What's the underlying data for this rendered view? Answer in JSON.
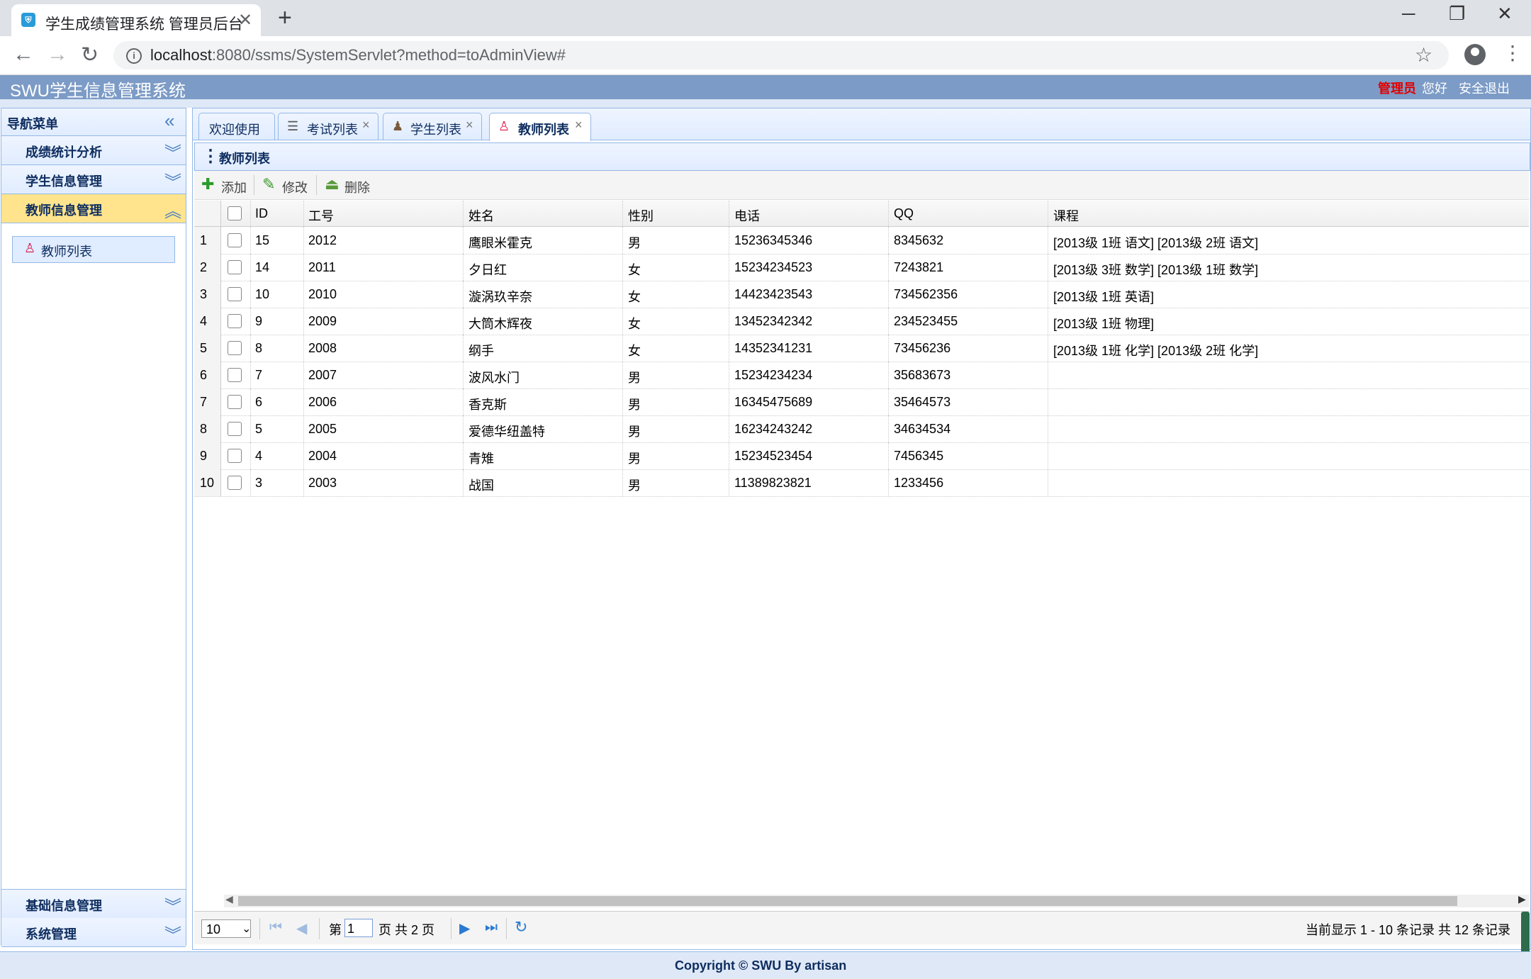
{
  "browser": {
    "tab_title": "学生成绩管理系统 管理员后台",
    "favicon": "app-icon",
    "url_host": "localhost",
    "url_rest": ":8080/ssms/SystemServlet?method=toAdminView#"
  },
  "header": {
    "title": "SWU学生信息管理系统",
    "role": "管理员",
    "greeting": "您好",
    "logout": "安全退出"
  },
  "nav": {
    "title": "导航菜单",
    "sections": [
      {
        "label": "成绩统计分析",
        "active": false
      },
      {
        "label": "学生信息管理",
        "active": false
      },
      {
        "label": "教师信息管理",
        "active": true
      },
      {
        "label": "基础信息管理",
        "active": false
      },
      {
        "label": "系统管理",
        "active": false
      }
    ],
    "active_item": "教师列表"
  },
  "tabs": [
    {
      "label": "欢迎使用",
      "icon": "",
      "closable": false
    },
    {
      "label": "考试列表",
      "icon": "list-icon",
      "closable": true
    },
    {
      "label": "学生列表",
      "icon": "student-icon",
      "closable": true
    },
    {
      "label": "教师列表",
      "icon": "teacher-icon",
      "closable": true,
      "selected": true
    }
  ],
  "grid": {
    "title": "教师列表",
    "toolbar": {
      "add": "添加",
      "edit": "修改",
      "delete": "删除"
    },
    "columns": [
      "ID",
      "工号",
      "姓名",
      "性别",
      "电话",
      "QQ",
      "课程"
    ],
    "rows": [
      {
        "n": "1",
        "id": "15",
        "sn": "2012",
        "name": "鹰眼米霍克",
        "sex": "男",
        "phone": "15236345346",
        "qq": "8345632",
        "course": "[2013级 1班 语文]    [2013级 2班 语文]"
      },
      {
        "n": "2",
        "id": "14",
        "sn": "2011",
        "name": "夕日红",
        "sex": "女",
        "phone": "15234234523",
        "qq": "7243821",
        "course": "[2013级 3班 数学]    [2013级 1班 数学]"
      },
      {
        "n": "3",
        "id": "10",
        "sn": "2010",
        "name": "漩涡玖辛奈",
        "sex": "女",
        "phone": "14423423543",
        "qq": "734562356",
        "course": "[2013级 1班 英语]"
      },
      {
        "n": "4",
        "id": "9",
        "sn": "2009",
        "name": "大筒木辉夜",
        "sex": "女",
        "phone": "13452342342",
        "qq": "234523455",
        "course": "[2013级 1班 物理]"
      },
      {
        "n": "5",
        "id": "8",
        "sn": "2008",
        "name": "纲手",
        "sex": "女",
        "phone": "14352341231",
        "qq": "73456236",
        "course": "[2013级 1班 化学]    [2013级 2班 化学]"
      },
      {
        "n": "6",
        "id": "7",
        "sn": "2007",
        "name": "波风水门",
        "sex": "男",
        "phone": "15234234234",
        "qq": "35683673",
        "course": ""
      },
      {
        "n": "7",
        "id": "6",
        "sn": "2006",
        "name": "香克斯",
        "sex": "男",
        "phone": "16345475689",
        "qq": "35464573",
        "course": ""
      },
      {
        "n": "8",
        "id": "5",
        "sn": "2005",
        "name": "爱德华纽盖特",
        "sex": "男",
        "phone": "16234243242",
        "qq": "34634534",
        "course": ""
      },
      {
        "n": "9",
        "id": "4",
        "sn": "2004",
        "name": "青雉",
        "sex": "男",
        "phone": "15234523454",
        "qq": "7456345",
        "course": ""
      },
      {
        "n": "10",
        "id": "3",
        "sn": "2003",
        "name": "战国",
        "sex": "男",
        "phone": "11389823821",
        "qq": "1233456",
        "course": ""
      }
    ]
  },
  "pager": {
    "page_size": "10",
    "page_prefix": "第",
    "page_value": "1",
    "page_suffix": "页 共 2 页",
    "summary": "当前显示 1 - 10 条记录 共 12 条记录"
  },
  "footer": {
    "copyright": "Copyright © SWU By artisan"
  },
  "colors": {
    "header_bg": "#7c9bc6",
    "panel_border": "#95b8e7",
    "active_nav": "#ffe48d",
    "role_red": "#e10000"
  }
}
